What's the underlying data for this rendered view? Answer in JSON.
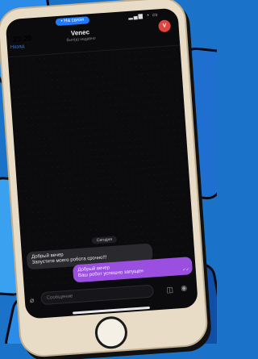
{
  "status_bar": {
    "time": "23:20",
    "call_pill": "• На связи",
    "icons": "▂▄▆ ◔ ▭"
  },
  "header": {
    "back_label": "Назад",
    "title": "Venec",
    "subtitle": "был(а) недавно",
    "avatar_letter": "V"
  },
  "chat": {
    "date_chip": "Сегодня",
    "messages": [
      {
        "direction": "in",
        "text": "Добрый вечер\nЗапустите моего робота срочно!!!"
      },
      {
        "direction": "out",
        "text": "Добрый вечер\nВаш робот успешно запущен",
        "checks": "✓✓"
      }
    ]
  },
  "composer": {
    "placeholder": "Сообщение"
  },
  "colors": {
    "outgoing_bubble": "#9b4fe0",
    "incoming_bubble": "#2a2a2e",
    "accent": "#1e7bff",
    "avatar": "#e0443e"
  }
}
